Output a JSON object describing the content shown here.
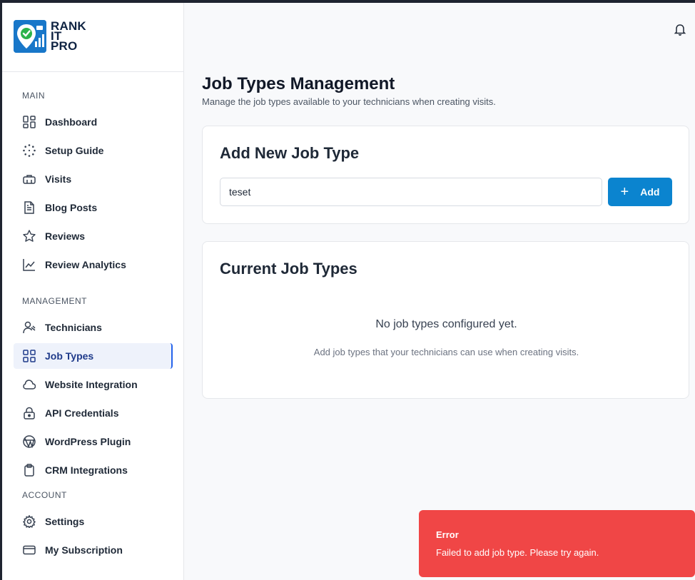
{
  "brand": {
    "line1": "RANK",
    "line2": "IT",
    "line3": "PRO"
  },
  "sidebar": {
    "sections": [
      {
        "label": "MAIN",
        "items": [
          {
            "label": "Dashboard",
            "icon": "grid-icon"
          },
          {
            "label": "Setup Guide",
            "icon": "dotted-circle-icon"
          },
          {
            "label": "Visits",
            "icon": "toolbox-icon"
          },
          {
            "label": "Blog Posts",
            "icon": "document-icon"
          },
          {
            "label": "Reviews",
            "icon": "star-icon"
          },
          {
            "label": "Review Analytics",
            "icon": "line-chart-icon"
          }
        ]
      },
      {
        "label": "MANAGEMENT",
        "items": [
          {
            "label": "Technicians",
            "icon": "user-icon"
          },
          {
            "label": "Job Types",
            "icon": "grid-icon",
            "active": true
          },
          {
            "label": "Website Integration",
            "icon": "cloud-icon"
          },
          {
            "label": "API Credentials",
            "icon": "lock-icon"
          },
          {
            "label": "WordPress Plugin",
            "icon": "globe-icon"
          },
          {
            "label": "CRM Integrations",
            "icon": "clipboard-icon"
          }
        ]
      },
      {
        "label": "ACCOUNT",
        "items": [
          {
            "label": "Settings",
            "icon": "gear-icon"
          },
          {
            "label": "My Subscription",
            "icon": "credit-card-icon"
          }
        ]
      }
    ]
  },
  "page": {
    "title": "Job Types Management",
    "subtitle": "Manage the job types available to your technicians when creating visits."
  },
  "add_card": {
    "title": "Add New Job Type",
    "input_value": "teset",
    "button_label": "Add"
  },
  "current_card": {
    "title": "Current Job Types",
    "empty_title": "No job types configured yet.",
    "empty_subtitle": "Add job types that your technicians can use when creating visits."
  },
  "toast": {
    "title": "Error",
    "message": "Failed to add job type. Please try again."
  },
  "colors": {
    "accent": "#0b84cf",
    "error": "#f04646",
    "brand": "#1877c9"
  }
}
